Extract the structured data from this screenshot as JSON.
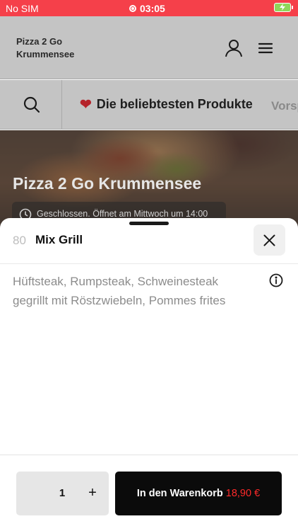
{
  "status_bar": {
    "carrier": "No SIM",
    "time": "03:05"
  },
  "header": {
    "brand_line1": "Pizza 2 Go",
    "brand_line2": "Krummensee",
    "icons": [
      "user-icon",
      "hamburger-menu-icon"
    ]
  },
  "categories": {
    "active": "Die beliebtesten Produkte",
    "next": "Vorspeisen"
  },
  "hero": {
    "title": "Pizza 2 Go Krummensee",
    "status": "Geschlossen. Öffnet am Mittwoch um 14:00"
  },
  "item": {
    "number": "80",
    "name": "Mix Grill",
    "description": "Hüftsteak, Rumpsteak, Schweinesteak gegrillt mit Röstzwiebeln, Pommes frites"
  },
  "footer": {
    "quantity": "1",
    "plus": "+",
    "add_label": "In den Warenkorb",
    "price": "18,90 €"
  },
  "colors": {
    "status_bar": "#f5404a",
    "overlay_gray": "#c4c4c4",
    "price_red": "#ff2a2a",
    "button_black": "#0b0b0b"
  }
}
